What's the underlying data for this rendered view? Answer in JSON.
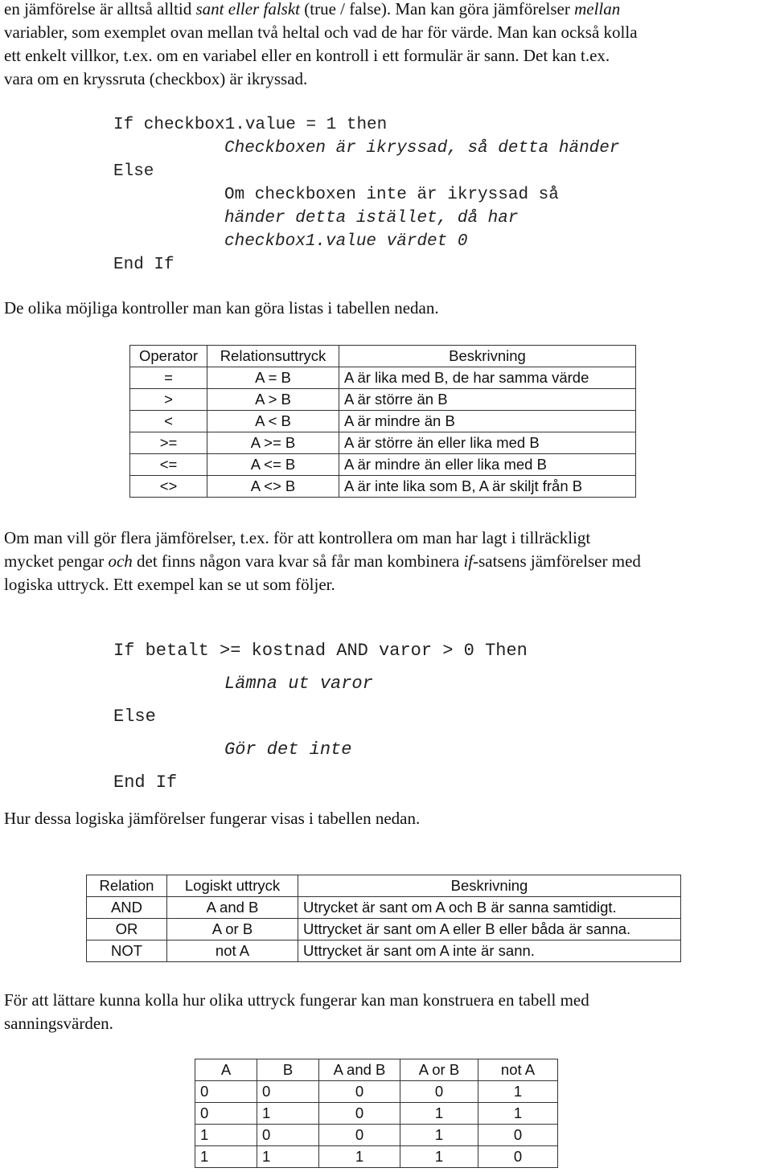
{
  "intro": {
    "line1_a": "en jämförelse är alltså alltid ",
    "line1_it": "sant eller falskt",
    "line1_b": " (true / false). Man kan göra jämförelser ",
    "line1_it2": "mellan",
    "line2": "variabler, som exemplet ovan mellan två heltal och vad de har för värde. Man kan också kolla",
    "line3": "ett enkelt villkor, t.ex. om en variabel eller en kontroll i ett formulär är sann. Det kan t.ex.",
    "line4": "vara om en kryssruta (checkbox) är ikryssad."
  },
  "code1": {
    "if_line": "If checkbox1.value = 1 then",
    "then_body": "Checkboxen är ikryssad, så detta händer",
    "else": "Else",
    "else_body_1": "Om checkboxen inte är ikryssad så",
    "else_body_2": "händer detta istället, då har",
    "else_body_3": "checkbox1.value värdet 0",
    "end_if": "End If"
  },
  "para_controls": "De olika möjliga kontroller man kan göra listas i tabellen nedan.",
  "table_operators": {
    "headers": [
      "Operator",
      "Relationsuttryck",
      "Beskrivning"
    ],
    "rows": [
      [
        "=",
        "A = B",
        "A är lika med B, de har samma värde"
      ],
      [
        ">",
        "A > B",
        "A är större än B"
      ],
      [
        "<",
        "A < B",
        "A är mindre än B"
      ],
      [
        ">=",
        "A >= B",
        "A är större än eller lika med B"
      ],
      [
        "<=",
        "A <= B",
        "A är mindre än eller lika med B"
      ],
      [
        "<>",
        "A <> B",
        "A är inte lika som B, A är skiljt från B"
      ]
    ]
  },
  "para_multi": {
    "line1": "Om man vill gör flera jämförelser, t.ex. för att kontrollera om man har lagt i tillräckligt",
    "line2_a": "mycket pengar ",
    "line2_it": "och",
    "line2_b": " det finns någon vara kvar så får man kombinera ",
    "line2_it2": "if",
    "line2_c": "-satsens jämförelser med",
    "line3": "logiska uttryck. Ett exempel kan se ut som följer."
  },
  "code2": {
    "if_line": "If betalt >= kostnad AND varor > 0 Then",
    "then_body": "Lämna ut varor",
    "else": "Else",
    "else_body": "Gör det inte",
    "end_if": "End If"
  },
  "para_logic": "Hur dessa logiska jämförelser fungerar visas i tabellen nedan.",
  "table_logic": {
    "headers": [
      "Relation",
      "Logiskt uttryck",
      "Beskrivning"
    ],
    "rows": [
      [
        "AND",
        "A and B",
        "Utrycket är sant om A och B är sanna samtidigt."
      ],
      [
        "OR",
        "A or B",
        "Uttrycket är sant om A eller B eller båda är sanna."
      ],
      [
        "NOT",
        "not A",
        "Uttrycket är sant om A inte är sann."
      ]
    ]
  },
  "para_truth": {
    "line1": "För att lättare kunna kolla hur olika uttryck fungerar kan man konstruera en tabell med",
    "line2": "sanningsvärden."
  },
  "table_truth": {
    "headers": [
      "A",
      "B",
      "A and B",
      "A or B",
      "not A"
    ],
    "rows": [
      [
        "0",
        "0",
        "0",
        "0",
        "1"
      ],
      [
        "0",
        "1",
        "0",
        "1",
        "1"
      ],
      [
        "1",
        "0",
        "0",
        "1",
        "0"
      ],
      [
        "1",
        "1",
        "1",
        "1",
        "0"
      ]
    ]
  }
}
